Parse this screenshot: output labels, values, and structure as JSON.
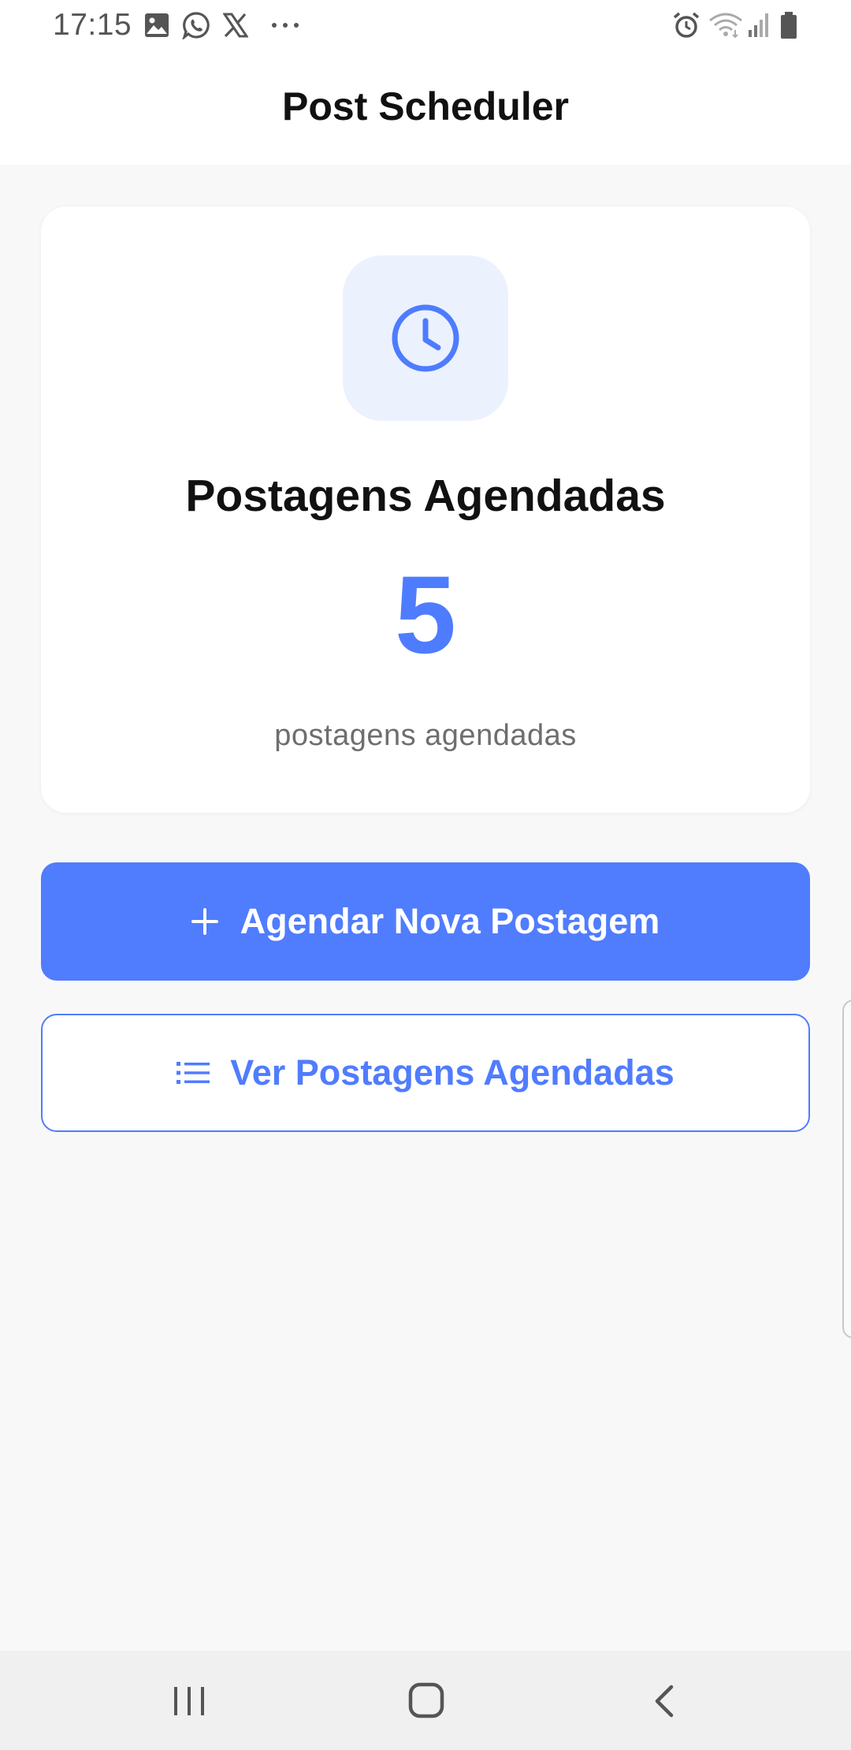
{
  "status_bar": {
    "time": "17:15",
    "left_icons": [
      "gallery-icon",
      "whatsapp-icon",
      "x-logo-icon",
      "more-notifications-icon"
    ],
    "right_icons": [
      "alarm-icon",
      "wifi-icon",
      "signal-icon",
      "battery-icon"
    ]
  },
  "header": {
    "title": "Post Scheduler"
  },
  "summary_card": {
    "icon": "clock-icon",
    "heading": "Postagens Agendadas",
    "count": "5",
    "caption": "postagens agendadas"
  },
  "actions": {
    "new_post": {
      "icon": "plus-icon",
      "label": "Agendar Nova Postagem"
    },
    "view_posts": {
      "icon": "list-icon",
      "label": "Ver Postagens Agendadas"
    }
  },
  "navigation": {
    "buttons": [
      "recent-apps-icon",
      "home-icon",
      "back-icon"
    ]
  },
  "colors": {
    "accent": "#507cfe",
    "icon_badge_bg": "#ebf2fe",
    "background": "#f8f8f8",
    "card": "#ffffff"
  }
}
